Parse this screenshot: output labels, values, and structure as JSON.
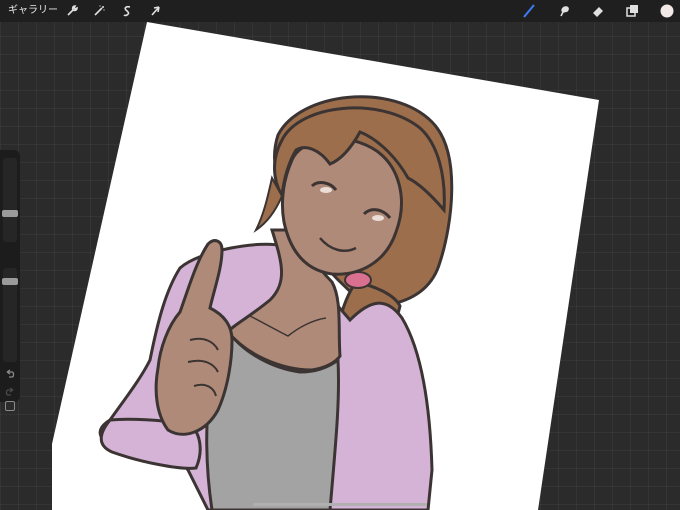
{
  "toolbar": {
    "gallery_label": "ギャラリー",
    "left_tools": [
      {
        "icon": "wrench-icon",
        "name": "actions"
      },
      {
        "icon": "magic-wand-icon",
        "name": "adjustments"
      },
      {
        "icon": "selection-s-icon",
        "name": "selection"
      },
      {
        "icon": "arrow-cursor-icon",
        "name": "transform"
      }
    ],
    "right_tools": [
      {
        "icon": "brush-icon",
        "name": "paint",
        "active_color": "#3d7cf5"
      },
      {
        "icon": "smudge-icon",
        "name": "smudge"
      },
      {
        "icon": "eraser-icon",
        "name": "eraser"
      },
      {
        "icon": "layers-icon",
        "name": "layers"
      }
    ],
    "current_color": "#f2e8e6"
  },
  "colors": {
    "skin": "#b08a78",
    "hair": "#9c6e4c",
    "cardigan": "#d4b3d6",
    "shirt": "#a3a3a3",
    "outline": "#3b3433",
    "hair_tie": "#d9708f",
    "canvas_bg": "#ffffff"
  }
}
